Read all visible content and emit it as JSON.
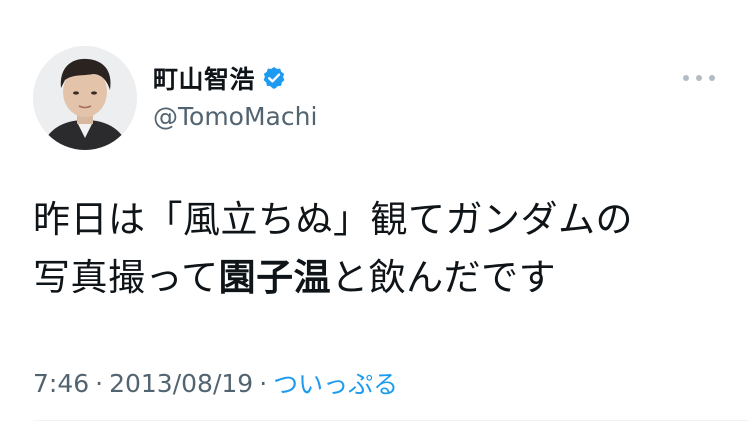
{
  "author": {
    "display_name": "町山智浩",
    "handle": "@TomoMachi",
    "avatar_icon": "avatar-photo",
    "verified_icon": "verified-badge-icon"
  },
  "tweet": {
    "line1": "昨日は「風立ちぬ」観てガンダムの",
    "line2_before": "写真撮って",
    "line2_bold": "園子温",
    "line2_after": "と飲んだです"
  },
  "meta": {
    "time": "7:46",
    "date": "2013/08/19",
    "separator": "·",
    "source": "ついっぷる"
  },
  "colors": {
    "text": "#0f1419",
    "secondary": "#536471",
    "accent": "#1d9bf0"
  },
  "icons": {
    "more": "more-horizontal-icon"
  }
}
